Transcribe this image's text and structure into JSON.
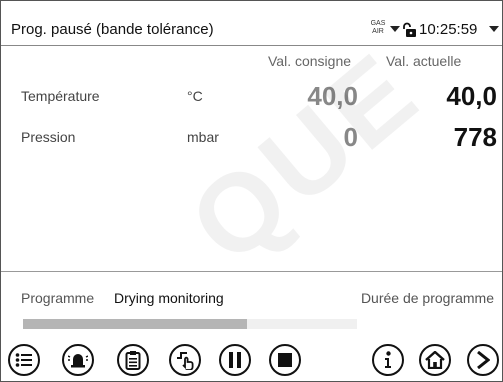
{
  "header": {
    "title": "Prog. pausé  (bande tolérance)",
    "gas_air": "GAS AIR",
    "time": "10:25:59"
  },
  "table": {
    "columns": {
      "setpoint": "Val. consigne",
      "actual": "Val. actuelle"
    },
    "rows": [
      {
        "label": "Température",
        "unit": "°C",
        "setpoint": "40,0",
        "actual": "40,0"
      },
      {
        "label": "Pression",
        "unit": "mbar",
        "setpoint": "0",
        "actual": "778"
      }
    ]
  },
  "program": {
    "label": "Programme",
    "name": "Drying monitoring",
    "duration_label": "Durée de programme",
    "progress": 0.67
  },
  "watermark": "QUE",
  "icons": [
    "menu-icon",
    "alarm-icon",
    "clipboard-icon",
    "manual-operation-icon",
    "pause-icon",
    "stop-icon",
    "info-icon",
    "home-icon",
    "next-icon"
  ],
  "colors": {
    "progress_fill": "#b5b5b5",
    "setpoint_text": "#888888",
    "actual_text": "#111111"
  }
}
